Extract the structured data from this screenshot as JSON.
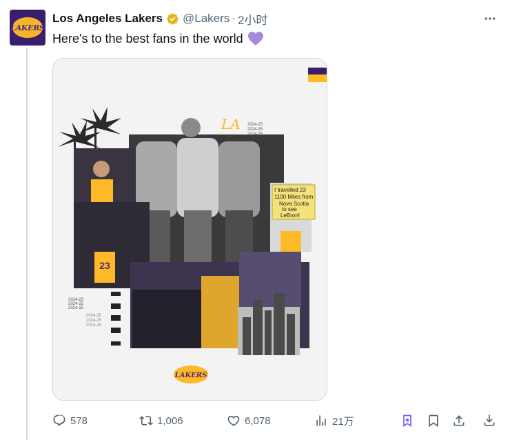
{
  "tweet": {
    "author_name": "Los Angeles Lakers",
    "handle": "@Lakers",
    "separator": "·",
    "time": "2小时",
    "text": "Here's to the best fans in the world",
    "avatar_text": "LAKERS",
    "more_icon": "more-horizontal-icon",
    "heart_emoji_color": "#a78bdb"
  },
  "media": {
    "logo_text": "LAKERS",
    "season_labels": [
      "2024-25",
      "2024-25",
      "2024-25"
    ],
    "season_labels_left_top": [
      "2024-25",
      "2024-25",
      "2024-25"
    ],
    "season_labels_left_bottom": [
      "2024-25",
      "2024-25",
      "2024-25"
    ],
    "sign_lines": [
      "I travelled 23",
      "1100 Miles from",
      "Nova Scotia",
      "to see",
      "LeBron!"
    ],
    "jersey_number": "23",
    "colors": {
      "purple": "#552583",
      "gold": "#FDB927",
      "background": "#f2f2f2"
    }
  },
  "actions": {
    "reply_count": "578",
    "retweet_count": "1,006",
    "like_count": "6,078",
    "view_count": "21万"
  },
  "colors": {
    "text_primary": "#0f1419",
    "text_secondary": "#536471",
    "verified_gold": "#e2b719",
    "bookmark_active": "#7856ff",
    "border": "#cfd9de"
  }
}
